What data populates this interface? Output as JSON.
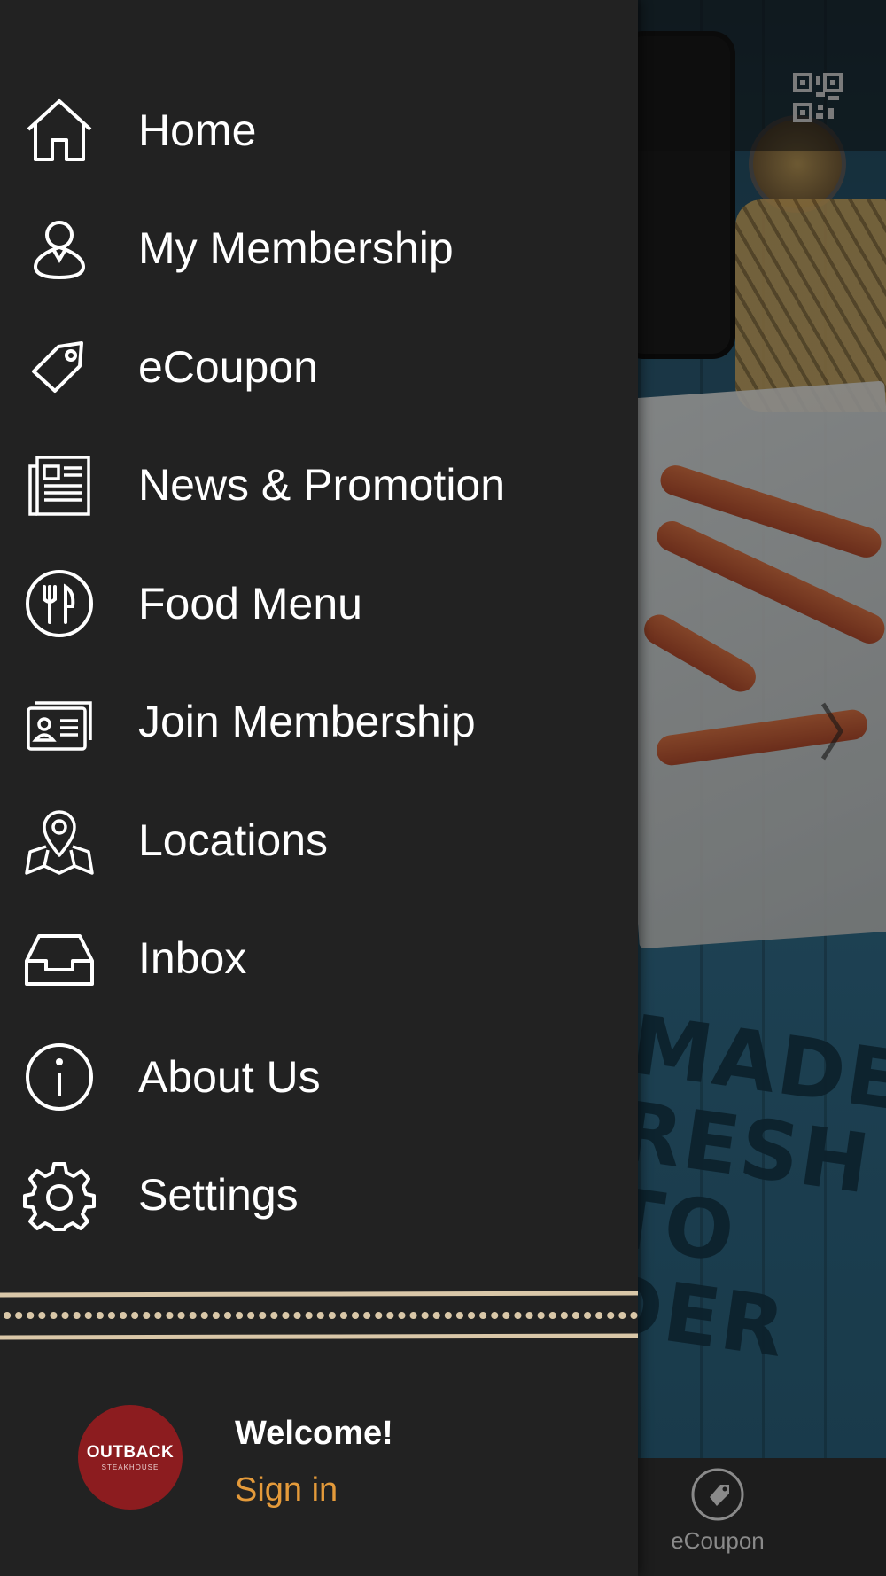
{
  "menu": {
    "items": [
      {
        "label": "Home",
        "icon": "home-icon"
      },
      {
        "label": "My Membership",
        "icon": "user-icon"
      },
      {
        "label": "eCoupon",
        "icon": "tag-icon"
      },
      {
        "label": "News & Promotion",
        "icon": "newspaper-icon"
      },
      {
        "label": "Food Menu",
        "icon": "fork-knife-icon"
      },
      {
        "label": "Join Membership",
        "icon": "id-card-icon"
      },
      {
        "label": "Locations",
        "icon": "map-pin-icon"
      },
      {
        "label": "Inbox",
        "icon": "inbox-icon"
      },
      {
        "label": "About Us",
        "icon": "info-icon"
      },
      {
        "label": "Settings",
        "icon": "gear-icon"
      }
    ]
  },
  "profile": {
    "logo_text": "OUTBACK",
    "logo_subtext": "STEAKHOUSE",
    "welcome": "Welcome!",
    "signin": "Sign in"
  },
  "background": {
    "promo_text_lines": [
      "MADE",
      "RESH",
      "TO",
      "DER"
    ],
    "bottom_tab_label": "eCoupon"
  },
  "colors": {
    "drawer_bg": "#222222",
    "accent_signin": "#e49a3a",
    "logo_red": "#8c1c1f",
    "divider": "#d9c7a8"
  }
}
